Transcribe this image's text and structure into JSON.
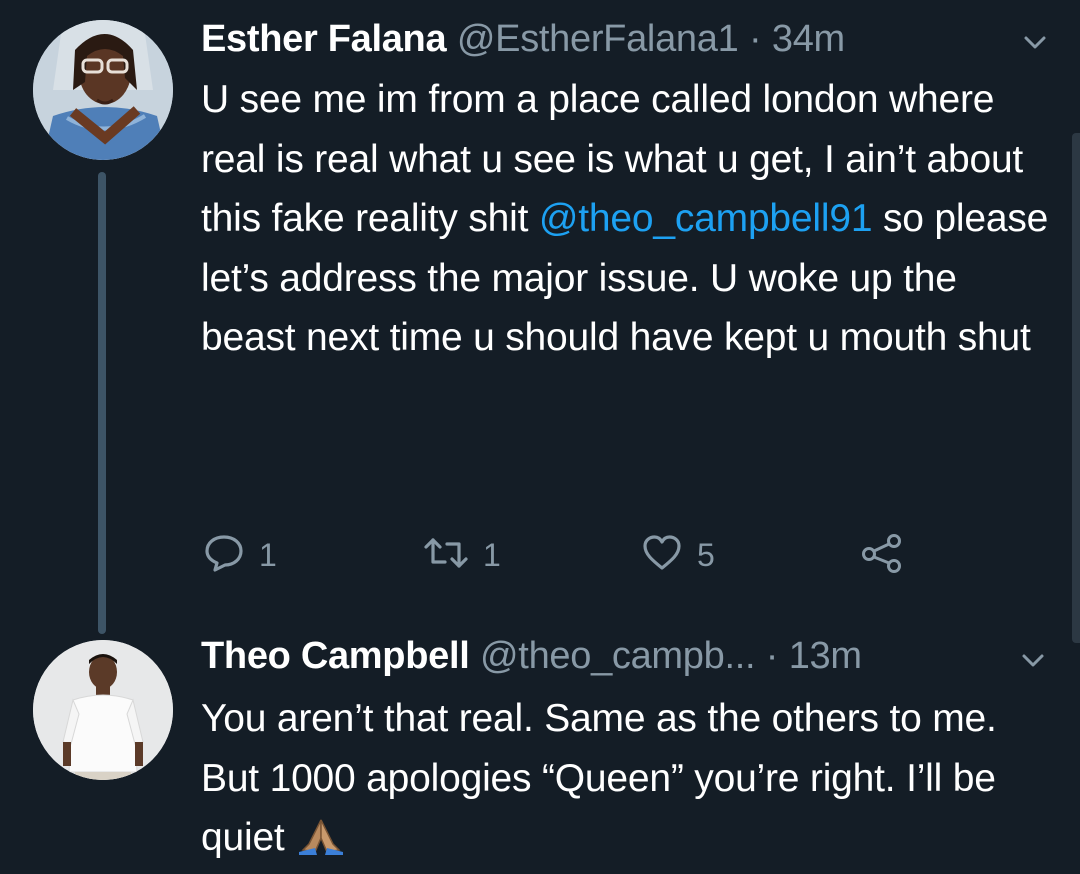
{
  "tweets": [
    {
      "author_name": "Esther Falana",
      "author_handle": "@EstherFalana1",
      "separator": "·",
      "time": "34m",
      "text_part1": "U see me im from a place called london where real is real what u see is what u get, I ain’t about this fake reality shit ",
      "mention": "@theo_campbell91",
      "text_part2": " so please let’s address the major issue. U woke up the beast next time u should have kept u mouth shut",
      "reply_count": "1",
      "retweet_count": "1",
      "like_count": "5"
    },
    {
      "author_name": "Theo Campbell",
      "author_handle": "@theo_campb...",
      "separator": "·",
      "time": "13m",
      "text": "You aren’t that real. Same as the others to me. But 1000 apologies “Queen” you’re right. I’ll be quiet",
      "emoji": "folded-hands-emoji"
    }
  ],
  "icons": {
    "reply": "reply-icon",
    "retweet": "retweet-icon",
    "like": "heart-icon",
    "share": "share-icon",
    "caret": "chevron-down-icon"
  },
  "colors": {
    "background": "#141d26",
    "text": "#ffffff",
    "secondary": "#8899a6",
    "mention": "#1da1f2",
    "thread_line": "#3d5466"
  }
}
